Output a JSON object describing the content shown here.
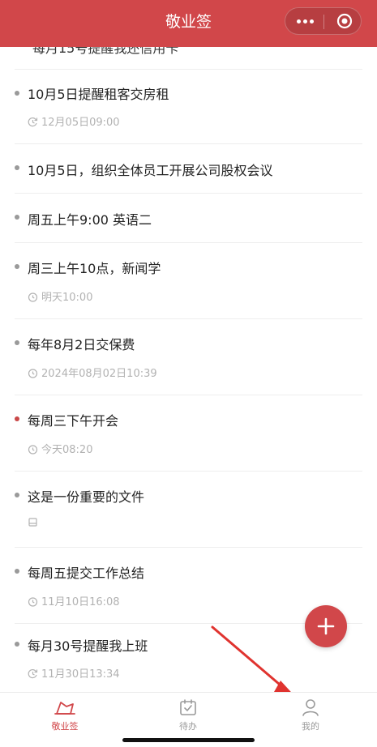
{
  "header": {
    "title": "敬业签"
  },
  "colors": {
    "brand": "#d1474a",
    "text": "#222222",
    "muted": "#b2b2b2",
    "dot": "#9a9a9a"
  },
  "partial_item": {
    "title": "每月15号提醒我还信用卡"
  },
  "items": [
    {
      "title": "10月5日提醒租客交房租",
      "time": "12月05日09:00",
      "icon": "repeat-clock-icon",
      "dot": "gray"
    },
    {
      "title": "10月5日，组织全体员工开展公司股权会议",
      "dot": "gray"
    },
    {
      "title": "周五上午9:00 英语二",
      "dot": "gray"
    },
    {
      "title": "周三上午10点，新闻学",
      "time": "明天10:00",
      "icon": "alarm-clock-icon",
      "dot": "gray"
    },
    {
      "title": "每年8月2日交保费",
      "time": "2024年08月02日10:39",
      "icon": "alarm-clock-icon",
      "dot": "gray"
    },
    {
      "title": "每周三下午开会",
      "time": "今天08:20",
      "icon": "alarm-clock-icon",
      "dot": "red"
    },
    {
      "title": "这是一份重要的文件",
      "icon": "archive-box-icon",
      "dot": "gray"
    },
    {
      "title": "每周五提交工作总结",
      "time": "11月10日16:08",
      "icon": "alarm-clock-icon",
      "dot": "gray"
    },
    {
      "title": "每月30号提醒我上班",
      "time": "11月30日13:34",
      "icon": "repeat-clock-icon",
      "dot": "gray"
    }
  ],
  "tabs": [
    {
      "label": "敬业签",
      "icon": "notes-icon",
      "active": true
    },
    {
      "label": "待办",
      "icon": "calendar-check-icon",
      "active": false
    },
    {
      "label": "我的",
      "icon": "user-icon",
      "active": false
    }
  ]
}
